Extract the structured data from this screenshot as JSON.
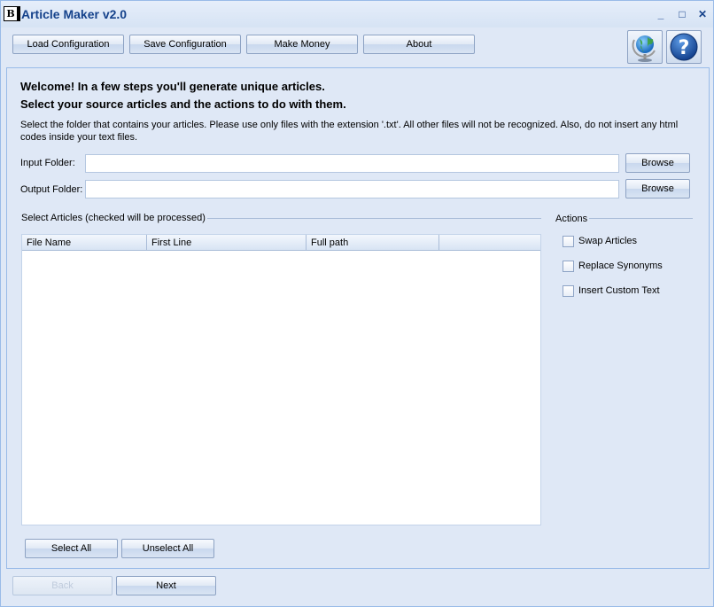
{
  "window": {
    "title": "Article Maker v2.0",
    "app_icon_glyph": "B",
    "minimize_glyph": "_",
    "maximize_glyph": "□",
    "close_glyph": "✕"
  },
  "toolbar": {
    "load_label": "Load Configuration",
    "save_label": "Save Configuration",
    "money_label": "Make Money",
    "about_label": "About",
    "globe_icon": "globe-icon",
    "help_icon": "help-icon"
  },
  "intro": {
    "heading1": "Welcome! In a few steps you'll generate unique articles.",
    "heading2": "Select your source articles and the actions to do with them.",
    "description": "Select the folder that contains your articles. Please use only files with the extension '.txt'. All other files will not be recognized. Also, do not insert any html codes inside your text files."
  },
  "folders": {
    "input_label": "Input Folder:",
    "input_value": "",
    "output_label": "Output Folder:",
    "output_value": "",
    "browse_label": "Browse"
  },
  "articles": {
    "group_title": "Select Articles (checked will be processed)",
    "columns": [
      "File Name",
      "First Line",
      "Full path",
      ""
    ],
    "rows": [],
    "select_all_label": "Select All",
    "unselect_all_label": "Unselect All"
  },
  "actions": {
    "group_title": "Actions",
    "options": [
      {
        "label": "Swap Articles",
        "checked": false
      },
      {
        "label": "Replace Synonyms",
        "checked": false
      },
      {
        "label": "Insert Custom Text",
        "checked": false
      }
    ]
  },
  "footer": {
    "back_label": "Back",
    "next_label": "Next"
  },
  "colors": {
    "window_bg": "#dfe8f6",
    "title_text": "#15428b",
    "border": "#99bbe8"
  }
}
